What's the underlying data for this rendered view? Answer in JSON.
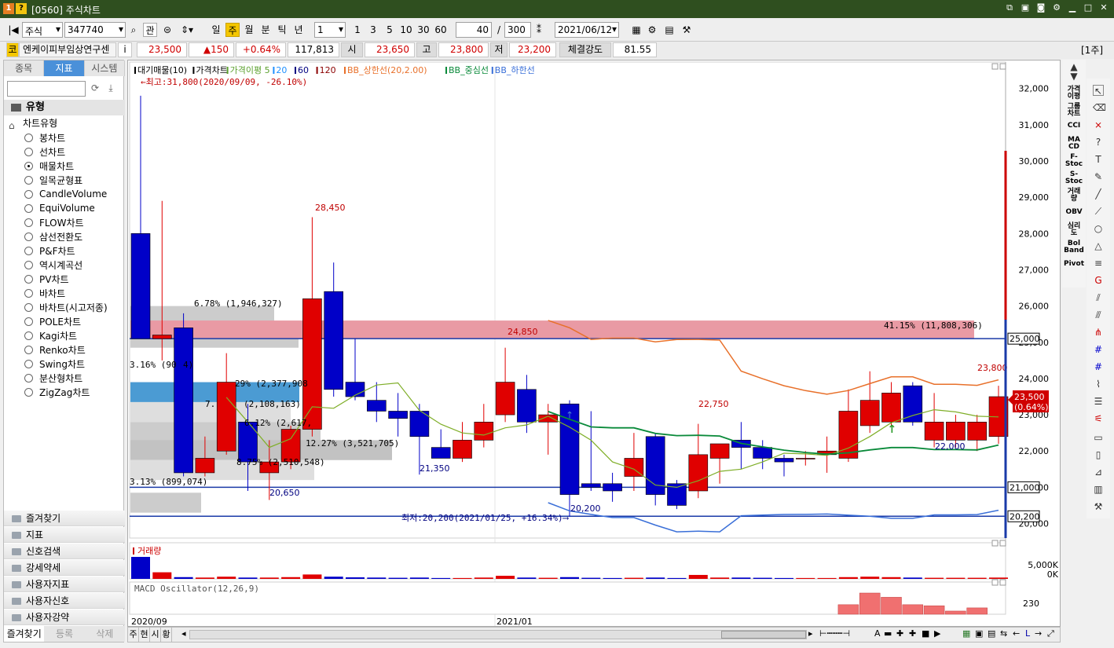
{
  "window": {
    "title": "[0560] 주식차트",
    "badge1": "1",
    "badge2": "?"
  },
  "toolbar": {
    "market": "주식",
    "code": "347740",
    "btn_gwan": "관",
    "periods": [
      "일",
      "주",
      "월",
      "분",
      "틱",
      "년"
    ],
    "active_period": "주",
    "interval": "1",
    "intervals": [
      "1",
      "3",
      "5",
      "10",
      "30",
      "60"
    ],
    "count": "40",
    "slash": "/",
    "total": "300",
    "date": "2021/06/12"
  },
  "quote": {
    "flag": "코",
    "name": "엔케이피부임상연구센",
    "info": "i",
    "price": "23,500",
    "change": "▲150",
    "rate": "+0.64%",
    "volume": "117,813",
    "open_label": "시",
    "open": "23,650",
    "high_label": "고",
    "high": "23,800",
    "low_label": "저",
    "low": "23,200",
    "strength_label": "체결강도",
    "strength": "81.55",
    "unit": "[1주]"
  },
  "left": {
    "tabs": [
      "종목",
      "지표",
      "시스템"
    ],
    "active_tab": "지표",
    "group": "유형",
    "subgroup": "차트유형",
    "items": [
      "봉차트",
      "선차트",
      "매물차트",
      "일목균형표",
      "CandleVolume",
      "EquiVolume",
      "FLOW차트",
      "삼선전환도",
      "P&F차트",
      "역시계곡선",
      "PV차트",
      "바차트",
      "바차트(시고저종)",
      "POLE차트",
      "Kagi차트",
      "Renko차트",
      "Swing차트",
      "분산형차트",
      "ZigZag차트"
    ],
    "selected": "매물차트",
    "folders": [
      "즐겨찾기",
      "지표",
      "신호검색",
      "강세약세",
      "사용자지표",
      "사용자신호",
      "사용자강약"
    ],
    "footer": [
      "즐겨찾기",
      "등록",
      "삭제"
    ]
  },
  "chart": {
    "legend": [
      "대기매물(10)",
      "가격차트",
      "가격이평 5",
      "20",
      "60",
      "120",
      "BB_상한선(20,2.00)",
      "BB_중심선",
      "BB_하한선"
    ],
    "legend_colors": [
      "#000000",
      "#000000",
      "#5aa02c",
      "#1e90ff",
      "#000080",
      "#8b0000",
      "#e8702a",
      "#0a8a3a",
      "#3a6fd8"
    ],
    "max_note": "←최고:31,800(2020/09/09, -26.10%)",
    "min_note": "최저:20,200(2021/01/25, +16.34%)⟶",
    "y_ticks": [
      "32,000",
      "31,000",
      "30,000",
      "29,000",
      "28,000",
      "27,000",
      "26,000",
      "25,000",
      "24,000",
      "23,000",
      "22,000",
      "21,000",
      "20,000"
    ],
    "price_labels": [
      "28,450",
      "24,850",
      "22,750",
      "23,800",
      "21,350",
      "20,650",
      "20,200",
      "22,000"
    ],
    "vp_labels": [
      "6.78% (1,946,327)",
      "3.16% (90",
      "4)",
      "29% (2,377,908",
      "7.",
      "(2,108,163)",
      "6.12% (2,617,",
      "12.27% (3,521,705)",
      "8.75% (2,510,548)",
      "3.13% (899,074)",
      "41.15% (11,808,306)"
    ],
    "level_tags": [
      "25,000",
      "21,000",
      "20,200"
    ],
    "current_tag": [
      "23,500",
      "(0.64%)"
    ],
    "volume_title": "거래량",
    "volume_ticks": [
      "5,000K",
      "0K"
    ],
    "macd_title": "MACD Oscillator(12,26,9)",
    "macd_tick": "230",
    "x_labels": [
      "2020/09",
      "2021/01"
    ]
  },
  "chart_data": {
    "type": "candlestick",
    "candles": [
      {
        "o": 28000,
        "h": 31800,
        "l": 25100,
        "c": 25100
      },
      {
        "o": 25100,
        "h": 28900,
        "l": 24500,
        "c": 25200
      },
      {
        "o": 25400,
        "h": 25800,
        "l": 21300,
        "c": 21400
      },
      {
        "o": 21400,
        "h": 22400,
        "l": 21300,
        "c": 21800
      },
      {
        "o": 22000,
        "h": 24700,
        "l": 21900,
        "c": 23900
      },
      {
        "o": 22800,
        "h": 23300,
        "l": 20900,
        "c": 21700
      },
      {
        "o": 21400,
        "h": 22300,
        "l": 20650,
        "c": 21700
      },
      {
        "o": 21700,
        "h": 22700,
        "l": 21500,
        "c": 22600
      },
      {
        "o": 22600,
        "h": 28450,
        "l": 22400,
        "c": 26200
      },
      {
        "o": 26400,
        "h": 27200,
        "l": 23500,
        "c": 23700
      },
      {
        "o": 23900,
        "h": 25100,
        "l": 23400,
        "c": 23500
      },
      {
        "o": 23400,
        "h": 23900,
        "l": 22800,
        "c": 23100
      },
      {
        "o": 23100,
        "h": 23600,
        "l": 22400,
        "c": 22900
      },
      {
        "o": 23100,
        "h": 23300,
        "l": 21350,
        "c": 22400
      },
      {
        "o": 22100,
        "h": 22600,
        "l": 21800,
        "c": 21800
      },
      {
        "o": 21800,
        "h": 22800,
        "l": 21700,
        "c": 22300
      },
      {
        "o": 22300,
        "h": 23300,
        "l": 22100,
        "c": 22800
      },
      {
        "o": 23000,
        "h": 24850,
        "l": 22800,
        "c": 23900
      },
      {
        "o": 23700,
        "h": 24100,
        "l": 22500,
        "c": 22800
      },
      {
        "o": 22800,
        "h": 23300,
        "l": 21900,
        "c": 23000
      },
      {
        "o": 23300,
        "h": 23400,
        "l": 20200,
        "c": 20800
      },
      {
        "o": 21100,
        "h": 23100,
        "l": 20900,
        "c": 21000
      },
      {
        "o": 21100,
        "h": 21400,
        "l": 20600,
        "c": 20900
      },
      {
        "o": 21300,
        "h": 22500,
        "l": 20900,
        "c": 21800
      },
      {
        "o": 22400,
        "h": 22500,
        "l": 20500,
        "c": 20800
      },
      {
        "o": 21100,
        "h": 21200,
        "l": 20400,
        "c": 20500
      },
      {
        "o": 20900,
        "h": 22750,
        "l": 20700,
        "c": 21900
      },
      {
        "o": 21800,
        "h": 22200,
        "l": 21100,
        "c": 22200
      },
      {
        "o": 22300,
        "h": 22800,
        "l": 21500,
        "c": 22100
      },
      {
        "o": 22100,
        "h": 22300,
        "l": 21500,
        "c": 21800
      },
      {
        "o": 21800,
        "h": 21900,
        "l": 21300,
        "c": 21700
      },
      {
        "o": 21800,
        "h": 22000,
        "l": 21600,
        "c": 21800
      },
      {
        "o": 21900,
        "h": 22400,
        "l": 21400,
        "c": 22000
      },
      {
        "o": 21800,
        "h": 23700,
        "l": 21700,
        "c": 23100
      },
      {
        "o": 22700,
        "h": 24200,
        "l": 22500,
        "c": 23400
      },
      {
        "o": 22800,
        "h": 23900,
        "l": 22700,
        "c": 23600
      },
      {
        "o": 23800,
        "h": 23900,
        "l": 22700,
        "c": 22800
      },
      {
        "o": 22300,
        "h": 23600,
        "l": 22100,
        "c": 22800
      },
      {
        "o": 22300,
        "h": 23000,
        "l": 22100,
        "c": 22800
      },
      {
        "o": 22300,
        "h": 23000,
        "l": 22000,
        "c": 22800
      },
      {
        "o": 22400,
        "h": 23800,
        "l": 22200,
        "c": 23500
      }
    ],
    "volume_pct": [
      100,
      30,
      8,
      6,
      10,
      6,
      6,
      8,
      20,
      10,
      7,
      6,
      5,
      6,
      4,
      4,
      6,
      14,
      6,
      5,
      8,
      5,
      4,
      5,
      6,
      4,
      18,
      6,
      6,
      5,
      4,
      4,
      4,
      8,
      10,
      8,
      6,
      5,
      5,
      5,
      6
    ],
    "macd_bars": [
      {
        "i": 33,
        "v": 0.45
      },
      {
        "i": 34,
        "v": 1.0
      },
      {
        "i": 35,
        "v": 0.8
      },
      {
        "i": 36,
        "v": 0.45
      },
      {
        "i": 37,
        "v": 0.4
      },
      {
        "i": 38,
        "v": 0.15
      },
      {
        "i": 39,
        "v": 0.3
      }
    ],
    "y_range": [
      19600,
      32600
    ]
  }
}
